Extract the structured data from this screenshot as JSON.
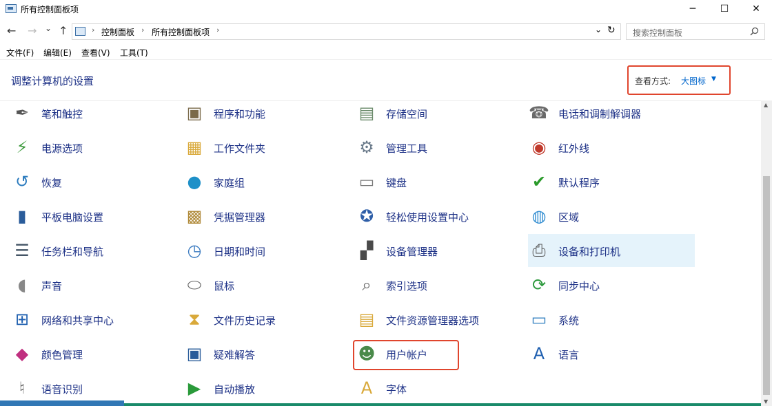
{
  "window": {
    "title": "所有控制面板项",
    "minimize": "─",
    "maximize": "☐",
    "close": "✕"
  },
  "nav": {
    "back": "←",
    "forward": "→",
    "recent": "⌄",
    "up": "↑",
    "dropdown": "⌄",
    "refresh": "↻"
  },
  "breadcrumb": [
    "控制面板",
    "所有控制面板项"
  ],
  "breadcrumb_sep": "›",
  "search": {
    "placeholder": "搜索控制面板",
    "icon": "search-icon"
  },
  "menu": [
    "文件(F)",
    "编辑(E)",
    "查看(V)",
    "工具(T)"
  ],
  "heading": "调整计算机的设置",
  "view": {
    "label": "查看方式:",
    "value": "大图标",
    "caret": "▼"
  },
  "items": [
    {
      "label": "笔和触控",
      "icon": "pen-icon"
    },
    {
      "label": "程序和功能",
      "icon": "programs-icon"
    },
    {
      "label": "存储空间",
      "icon": "storage-icon"
    },
    {
      "label": "电话和调制解调器",
      "icon": "phone-modem-icon"
    },
    {
      "label": "电源选项",
      "icon": "power-icon"
    },
    {
      "label": "工作文件夹",
      "icon": "work-folders-icon"
    },
    {
      "label": "管理工具",
      "icon": "admin-tools-icon"
    },
    {
      "label": "红外线",
      "icon": "infrared-icon"
    },
    {
      "label": "恢复",
      "icon": "recovery-icon"
    },
    {
      "label": "家庭组",
      "icon": "homegroup-icon"
    },
    {
      "label": "键盘",
      "icon": "keyboard-icon"
    },
    {
      "label": "默认程序",
      "icon": "default-programs-icon"
    },
    {
      "label": "平板电脑设置",
      "icon": "tablet-icon"
    },
    {
      "label": "凭据管理器",
      "icon": "credential-icon"
    },
    {
      "label": "轻松使用设置中心",
      "icon": "ease-of-access-icon"
    },
    {
      "label": "区域",
      "icon": "region-icon"
    },
    {
      "label": "任务栏和导航",
      "icon": "taskbar-icon"
    },
    {
      "label": "日期和时间",
      "icon": "datetime-icon"
    },
    {
      "label": "设备管理器",
      "icon": "device-manager-icon"
    },
    {
      "label": "设备和打印机",
      "icon": "printer-icon"
    },
    {
      "label": "声音",
      "icon": "sound-icon"
    },
    {
      "label": "鼠标",
      "icon": "mouse-icon"
    },
    {
      "label": "索引选项",
      "icon": "indexing-icon"
    },
    {
      "label": "同步中心",
      "icon": "sync-icon"
    },
    {
      "label": "网络和共享中心",
      "icon": "network-icon"
    },
    {
      "label": "文件历史记录",
      "icon": "file-history-icon"
    },
    {
      "label": "文件资源管理器选项",
      "icon": "explorer-options-icon"
    },
    {
      "label": "系统",
      "icon": "system-icon"
    },
    {
      "label": "颜色管理",
      "icon": "color-icon"
    },
    {
      "label": "疑难解答",
      "icon": "troubleshoot-icon"
    },
    {
      "label": "用户帐户",
      "icon": "user-accounts-icon"
    },
    {
      "label": "语言",
      "icon": "language-icon"
    },
    {
      "label": "语音识别",
      "icon": "microphone-icon"
    },
    {
      "label": "自动播放",
      "icon": "autoplay-icon"
    },
    {
      "label": "字体",
      "icon": "fonts-icon"
    }
  ],
  "scroll": {
    "up": "▲",
    "down": "▼"
  },
  "colors": {
    "link": "#1e3287",
    "highlight": "#e5f3fb",
    "annotation": "#e0452d"
  }
}
